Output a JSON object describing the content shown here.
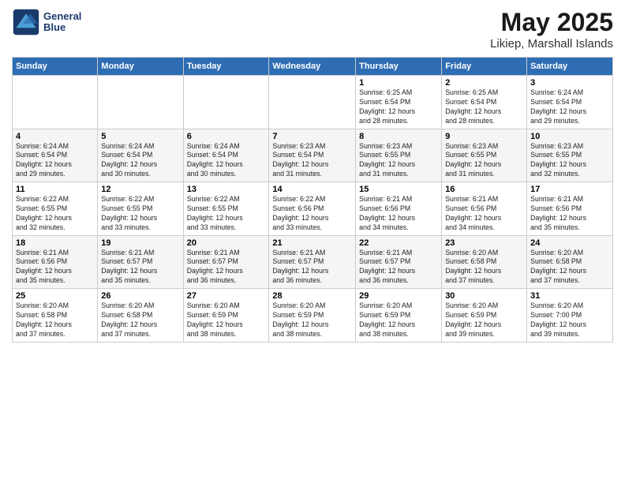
{
  "logo": {
    "line1": "General",
    "line2": "Blue"
  },
  "title": "May 2025",
  "subtitle": "Likiep, Marshall Islands",
  "weekdays": [
    "Sunday",
    "Monday",
    "Tuesday",
    "Wednesday",
    "Thursday",
    "Friday",
    "Saturday"
  ],
  "weeks": [
    [
      {
        "day": "",
        "info": ""
      },
      {
        "day": "",
        "info": ""
      },
      {
        "day": "",
        "info": ""
      },
      {
        "day": "",
        "info": ""
      },
      {
        "day": "1",
        "info": "Sunrise: 6:25 AM\nSunset: 6:54 PM\nDaylight: 12 hours\nand 28 minutes."
      },
      {
        "day": "2",
        "info": "Sunrise: 6:25 AM\nSunset: 6:54 PM\nDaylight: 12 hours\nand 28 minutes."
      },
      {
        "day": "3",
        "info": "Sunrise: 6:24 AM\nSunset: 6:54 PM\nDaylight: 12 hours\nand 29 minutes."
      }
    ],
    [
      {
        "day": "4",
        "info": "Sunrise: 6:24 AM\nSunset: 6:54 PM\nDaylight: 12 hours\nand 29 minutes."
      },
      {
        "day": "5",
        "info": "Sunrise: 6:24 AM\nSunset: 6:54 PM\nDaylight: 12 hours\nand 30 minutes."
      },
      {
        "day": "6",
        "info": "Sunrise: 6:24 AM\nSunset: 6:54 PM\nDaylight: 12 hours\nand 30 minutes."
      },
      {
        "day": "7",
        "info": "Sunrise: 6:23 AM\nSunset: 6:54 PM\nDaylight: 12 hours\nand 31 minutes."
      },
      {
        "day": "8",
        "info": "Sunrise: 6:23 AM\nSunset: 6:55 PM\nDaylight: 12 hours\nand 31 minutes."
      },
      {
        "day": "9",
        "info": "Sunrise: 6:23 AM\nSunset: 6:55 PM\nDaylight: 12 hours\nand 31 minutes."
      },
      {
        "day": "10",
        "info": "Sunrise: 6:23 AM\nSunset: 6:55 PM\nDaylight: 12 hours\nand 32 minutes."
      }
    ],
    [
      {
        "day": "11",
        "info": "Sunrise: 6:22 AM\nSunset: 6:55 PM\nDaylight: 12 hours\nand 32 minutes."
      },
      {
        "day": "12",
        "info": "Sunrise: 6:22 AM\nSunset: 6:55 PM\nDaylight: 12 hours\nand 33 minutes."
      },
      {
        "day": "13",
        "info": "Sunrise: 6:22 AM\nSunset: 6:55 PM\nDaylight: 12 hours\nand 33 minutes."
      },
      {
        "day": "14",
        "info": "Sunrise: 6:22 AM\nSunset: 6:56 PM\nDaylight: 12 hours\nand 33 minutes."
      },
      {
        "day": "15",
        "info": "Sunrise: 6:21 AM\nSunset: 6:56 PM\nDaylight: 12 hours\nand 34 minutes."
      },
      {
        "day": "16",
        "info": "Sunrise: 6:21 AM\nSunset: 6:56 PM\nDaylight: 12 hours\nand 34 minutes."
      },
      {
        "day": "17",
        "info": "Sunrise: 6:21 AM\nSunset: 6:56 PM\nDaylight: 12 hours\nand 35 minutes."
      }
    ],
    [
      {
        "day": "18",
        "info": "Sunrise: 6:21 AM\nSunset: 6:56 PM\nDaylight: 12 hours\nand 35 minutes."
      },
      {
        "day": "19",
        "info": "Sunrise: 6:21 AM\nSunset: 6:57 PM\nDaylight: 12 hours\nand 35 minutes."
      },
      {
        "day": "20",
        "info": "Sunrise: 6:21 AM\nSunset: 6:57 PM\nDaylight: 12 hours\nand 36 minutes."
      },
      {
        "day": "21",
        "info": "Sunrise: 6:21 AM\nSunset: 6:57 PM\nDaylight: 12 hours\nand 36 minutes."
      },
      {
        "day": "22",
        "info": "Sunrise: 6:21 AM\nSunset: 6:57 PM\nDaylight: 12 hours\nand 36 minutes."
      },
      {
        "day": "23",
        "info": "Sunrise: 6:20 AM\nSunset: 6:58 PM\nDaylight: 12 hours\nand 37 minutes."
      },
      {
        "day": "24",
        "info": "Sunrise: 6:20 AM\nSunset: 6:58 PM\nDaylight: 12 hours\nand 37 minutes."
      }
    ],
    [
      {
        "day": "25",
        "info": "Sunrise: 6:20 AM\nSunset: 6:58 PM\nDaylight: 12 hours\nand 37 minutes."
      },
      {
        "day": "26",
        "info": "Sunrise: 6:20 AM\nSunset: 6:58 PM\nDaylight: 12 hours\nand 37 minutes."
      },
      {
        "day": "27",
        "info": "Sunrise: 6:20 AM\nSunset: 6:59 PM\nDaylight: 12 hours\nand 38 minutes."
      },
      {
        "day": "28",
        "info": "Sunrise: 6:20 AM\nSunset: 6:59 PM\nDaylight: 12 hours\nand 38 minutes."
      },
      {
        "day": "29",
        "info": "Sunrise: 6:20 AM\nSunset: 6:59 PM\nDaylight: 12 hours\nand 38 minutes."
      },
      {
        "day": "30",
        "info": "Sunrise: 6:20 AM\nSunset: 6:59 PM\nDaylight: 12 hours\nand 39 minutes."
      },
      {
        "day": "31",
        "info": "Sunrise: 6:20 AM\nSunset: 7:00 PM\nDaylight: 12 hours\nand 39 minutes."
      }
    ]
  ]
}
